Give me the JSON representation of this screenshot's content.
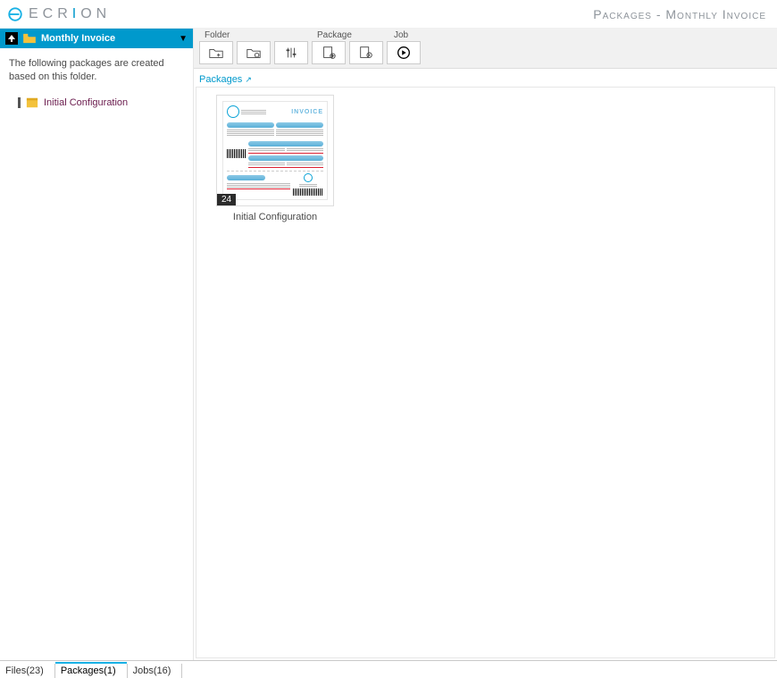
{
  "brand": {
    "name_pre": "ECR",
    "name_accent": "I",
    "name_post": "ON"
  },
  "breadcrumb": "Packages - Monthly Invoice",
  "sidebar": {
    "up_tooltip": "Up",
    "current_folder": "Monthly Invoice",
    "description": "The following packages are created based on this folder.",
    "items": [
      {
        "label": "Initial Configuration"
      }
    ]
  },
  "toolbar": {
    "groups": {
      "folder": "Folder",
      "package": "Package",
      "job": "Job"
    },
    "buttons": [
      {
        "name": "folder-new",
        "group": "folder"
      },
      {
        "name": "folder-settings",
        "group": "folder"
      },
      {
        "name": "folder-tools",
        "group": "folder"
      },
      {
        "name": "package-new",
        "group": "package"
      },
      {
        "name": "package-settings",
        "group": "package"
      },
      {
        "name": "job-run",
        "group": "job"
      }
    ]
  },
  "packages_section": {
    "title": "Packages",
    "items": [
      {
        "label": "Initial Configuration",
        "page_count": "24",
        "thumb_invoice_word": "INVOICE"
      }
    ]
  },
  "footer_tabs": [
    {
      "label": "Files",
      "count": 23,
      "active": false
    },
    {
      "label": "Packages",
      "count": 1,
      "active": true
    },
    {
      "label": "Jobs",
      "count": 16,
      "active": false
    }
  ],
  "icons": {
    "up": "up-arrow-icon",
    "folder": "folder-icon",
    "dropdown": "chevron-down-icon",
    "package": "package-icon",
    "popout": "popout-icon"
  }
}
